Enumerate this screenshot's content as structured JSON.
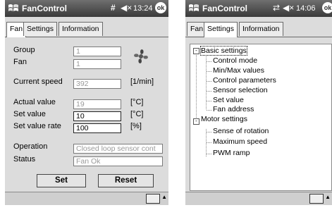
{
  "screen1": {
    "titlebar": {
      "title": "FanControl",
      "signal_icon": "#",
      "time": "13:24",
      "ok_label": "ok"
    },
    "tabs": [
      {
        "label": "Fan",
        "active": true
      },
      {
        "label": "Settings",
        "active": false
      },
      {
        "label": "Information",
        "active": false
      }
    ],
    "fields": {
      "group": {
        "label": "Group",
        "value": "1"
      },
      "fan": {
        "label": "Fan",
        "value": "1"
      },
      "current_speed": {
        "label": "Current speed",
        "value": "392",
        "unit": "[1/min]"
      },
      "actual_value": {
        "label": "Actual value",
        "value": "19",
        "unit": "[°C]"
      },
      "set_value": {
        "label": "Set value",
        "value": "10",
        "unit": "[°C]"
      },
      "set_value_rate": {
        "label": "Set value rate",
        "value": "100",
        "unit": "[%]"
      },
      "operation": {
        "label": "Operation",
        "value": "Closed loop sensor cont"
      },
      "status": {
        "label": "Status",
        "value": "Fan Ok"
      }
    },
    "buttons": {
      "set": "Set",
      "reset": "Reset"
    }
  },
  "screen2": {
    "titlebar": {
      "title": "FanControl",
      "time": "14:06",
      "ok_label": "ok"
    },
    "tabs": [
      {
        "label": "Fan",
        "active": false
      },
      {
        "label": "Settings",
        "active": true
      },
      {
        "label": "Information",
        "active": false
      }
    ],
    "tree": {
      "basic": {
        "label": "Basic settings",
        "expander": "-",
        "children": [
          "Control mode",
          "Min/Max values",
          "Control parameters",
          "Sensor selection",
          "Set value",
          "Fan address"
        ]
      },
      "motor": {
        "label": "Motor settings",
        "expander": "-",
        "children": [
          "Sense of rotation",
          "Maximum speed",
          "PWM ramp"
        ]
      }
    }
  },
  "colors": {
    "titlebar": "#4a4a4a",
    "panel": "#dcdcdc",
    "readonly_text": "#9a9a9a"
  },
  "icons": [
    "windows-flag-icon",
    "signal-icon",
    "speaker-icon",
    "ok-button-icon",
    "fan-icon",
    "keyboard-icon"
  ]
}
